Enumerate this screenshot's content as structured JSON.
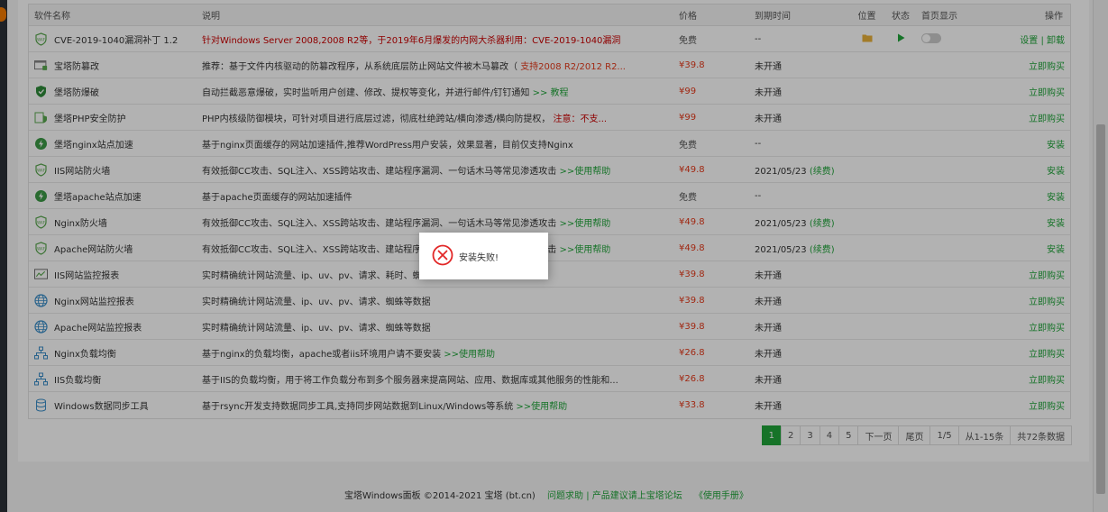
{
  "header": {
    "name": "软件名称",
    "desc": "说明",
    "price": "价格",
    "expire": "到期时间",
    "location": "位置",
    "status": "状态",
    "home": "首页显示",
    "op": "操作"
  },
  "rows": [
    {
      "icon": "waf-icon",
      "name": "CVE-2019-1040漏洞补丁 1.2",
      "desc": "针对Windows Server 2008,2008 R2等，于2019年6月爆发的内网大杀器利用：CVE-2019-1040漏洞",
      "desc_extra": "",
      "price": "免费",
      "expire": "--",
      "renew": "",
      "op": "设置",
      "op2": "卸载"
    },
    {
      "icon": "tamper-icon",
      "name": "宝塔防篡改",
      "desc": "推荐：基于文件内核驱动的防篡改程序，从系统底层防止网站文件被木马篡改（",
      "desc_extra": "支持2008 R2/2012 R2...",
      "price": "¥39.8",
      "expire": "未开通",
      "renew": "",
      "op": "立即购买",
      "op2": ""
    },
    {
      "icon": "shield-icon",
      "name": "堡塔防爆破",
      "desc": "自动拦截恶意爆破，实时监听用户创建、修改、提权等变化，并进行邮件/钉钉通知",
      "desc_extra": ">> 教程",
      "price": "¥99",
      "expire": "未开通",
      "renew": "",
      "op": "立即购买",
      "op2": ""
    },
    {
      "icon": "php-shield-icon",
      "name": "堡塔PHP安全防护",
      "desc": "PHP内核级防御模块，可针对项目进行底层过滤，彻底杜绝跨站/横向渗透/横向防提权，",
      "desc_extra": "注意：不支...",
      "price": "¥99",
      "expire": "未开通",
      "renew": "",
      "op": "立即购买",
      "op2": ""
    },
    {
      "icon": "bolt-icon",
      "name": "堡塔nginx站点加速",
      "desc": "基于nginx页面缓存的网站加速插件,推荐WordPress用户安装，效果显著，目前仅支持Nginx",
      "desc_extra": "",
      "price": "免费",
      "expire": "--",
      "renew": "",
      "op": "安装",
      "op2": ""
    },
    {
      "icon": "waf-icon",
      "name": "IIS网站防火墙",
      "desc": "有效抵御CC攻击、SQL注入、XSS跨站攻击、建站程序漏洞、一句话木马等常见渗透攻击",
      "desc_extra": ">>使用帮助",
      "price": "¥49.8",
      "expire": "2021/05/23",
      "renew": "(续费)",
      "op": "安装",
      "op2": ""
    },
    {
      "icon": "bolt-icon",
      "name": "堡塔apache站点加速",
      "desc": "基于apache页面缓存的网站加速插件",
      "desc_extra": "",
      "price": "免费",
      "expire": "--",
      "renew": "",
      "op": "安装",
      "op2": ""
    },
    {
      "icon": "waf-icon",
      "name": "Nginx防火墙",
      "desc": "有效抵御CC攻击、SQL注入、XSS跨站攻击、建站程序漏洞、一句话木马等常见渗透攻击",
      "desc_extra": ">>使用帮助",
      "price": "¥49.8",
      "expire": "2021/05/23",
      "renew": "(续费)",
      "op": "安装",
      "op2": ""
    },
    {
      "icon": "waf-icon",
      "name": "Apache网站防火墙",
      "desc": "有效抵御CC攻击、SQL注入、XSS跨站攻击、建站程序漏洞、一句话木马等常见渗透攻击",
      "desc_extra": ">>使用帮助",
      "price": "¥49.8",
      "expire": "2021/05/23",
      "renew": "(续费)",
      "op": "安装",
      "op2": ""
    },
    {
      "icon": "chart-icon",
      "name": "IIS网站监控报表",
      "desc": "实时精确统计网站流量、ip、uv、pv、请求、耗时、蜘蛛等数据",
      "desc_extra": "",
      "price": "¥39.8",
      "expire": "未开通",
      "renew": "",
      "op": "立即购买",
      "op2": ""
    },
    {
      "icon": "globe-icon",
      "name": "Nginx网站监控报表",
      "desc": "实时精确统计网站流量、ip、uv、pv、请求、蜘蛛等数据",
      "desc_extra": "",
      "price": "¥39.8",
      "expire": "未开通",
      "renew": "",
      "op": "立即购买",
      "op2": ""
    },
    {
      "icon": "globe-icon",
      "name": "Apache网站监控报表",
      "desc": "实时精确统计网站流量、ip、uv、pv、请求、蜘蛛等数据",
      "desc_extra": "",
      "price": "¥39.8",
      "expire": "未开通",
      "renew": "",
      "op": "立即购买",
      "op2": ""
    },
    {
      "icon": "network-icon",
      "name": "Nginx负载均衡",
      "desc": "基于nginx的负载均衡，apache或者iis环境用户请不要安装",
      "desc_extra": ">>使用帮助",
      "price": "¥26.8",
      "expire": "未开通",
      "renew": "",
      "op": "立即购买",
      "op2": ""
    },
    {
      "icon": "network-icon",
      "name": "IIS负载均衡",
      "desc": "基于IIS的负载均衡，用于将工作负载分布到多个服务器来提高网站、应用、数据库或其他服务的性能和...",
      "desc_extra": "",
      "price": "¥26.8",
      "expire": "未开通",
      "renew": "",
      "op": "立即购买",
      "op2": ""
    },
    {
      "icon": "database-icon",
      "name": "Windows数据同步工具",
      "desc": "基于rsync开发支持数据同步工具,支持同步网站数据到Linux/Windows等系统",
      "desc_extra": ">>使用帮助",
      "price": "¥33.8",
      "expire": "未开通",
      "renew": "",
      "op": "立即购买",
      "op2": ""
    }
  ],
  "pager": {
    "pages": [
      "1",
      "2",
      "3",
      "4",
      "5"
    ],
    "next": "下一页",
    "last": "尾页",
    "ratio": "1/5",
    "range": "从1-15条",
    "total": "共72条数据"
  },
  "footer": {
    "copyright": "宝塔Windows面板 ©2014-2021 宝塔 (bt.cn)",
    "help": "问题求助 | 产品建议请上宝塔论坛",
    "manual": "《使用手册》"
  },
  "dialog": {
    "message": "安装失败!"
  },
  "colors": {
    "accent": "#20a53a",
    "price": "#e63a1b",
    "warn": "#cc0000",
    "error": "#e22828"
  }
}
